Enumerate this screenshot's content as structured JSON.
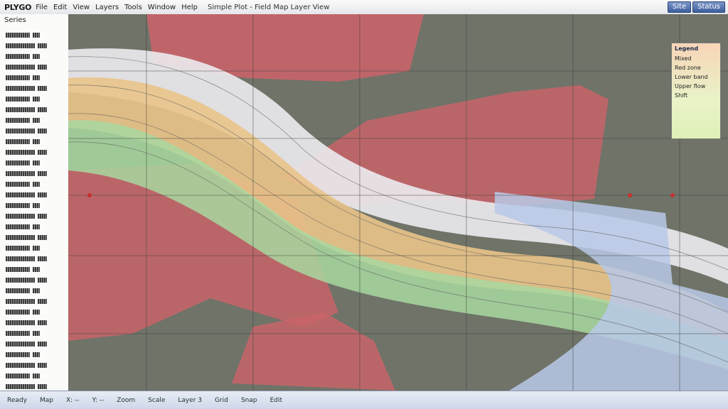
{
  "window": {
    "app_name": "PLYGO",
    "menu": [
      "File",
      "Edit",
      "View",
      "Layers",
      "Tools",
      "Window",
      "Help"
    ],
    "title": "Simple Plot - Field Map Layer View",
    "right_buttons": [
      "Site",
      "Status"
    ]
  },
  "sidebar": {
    "header": "Series",
    "rows": 34
  },
  "legend": {
    "title": "Legend",
    "items": [
      "Mixed",
      "Red zone",
      "Lower band",
      "Upper flow",
      "Shift"
    ],
    "colors": {
      "red": "#c8646a",
      "gray": "#6f7368",
      "orange": "#e9c48a",
      "green": "#a8d8a0",
      "blue": "#b9c9e8",
      "white": "#ecebf0"
    }
  },
  "statusbar": {
    "items": [
      "Ready",
      "Map",
      "X: --",
      "Y: --",
      "Zoom",
      "Scale",
      "Layer 3",
      "Grid",
      "Snap",
      "Edit"
    ]
  }
}
